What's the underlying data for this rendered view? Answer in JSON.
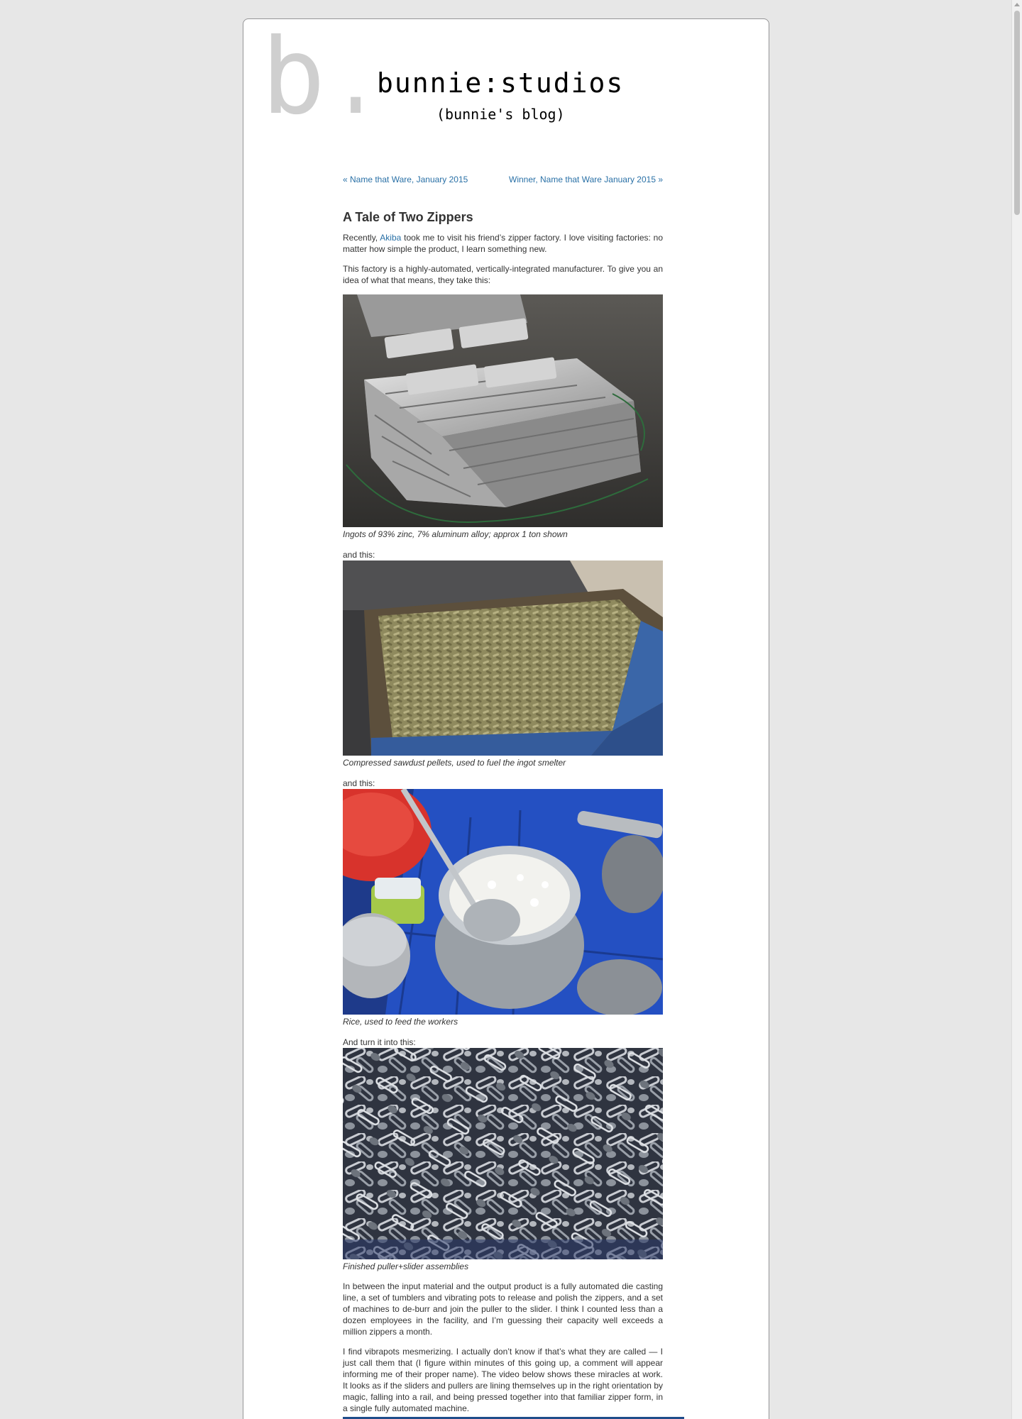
{
  "site": {
    "logo_letter": "b.",
    "title": "bunnie:studios",
    "description": "(bunnie's blog)"
  },
  "nav": {
    "prev": "« Name that Ware, January 2015",
    "next": "Winner, Name that Ware January 2015 »"
  },
  "post": {
    "title": "A Tale of Two Zippers",
    "p1_before": "Recently, ",
    "p1_link": "Akiba",
    "p1_after": " took me to visit his friend’s zipper factory. I love visiting factories: no matter how simple the product, I learn something new.",
    "p2": "This factory is a highly-automated, vertically-integrated manufacturer. To give you an idea of what that means, they take this:",
    "caption1": "Ingots of 93% zinc, 7% aluminum alloy; approx 1 ton shown",
    "lead2": "and this:",
    "caption2": "Compressed sawdust pellets, used to fuel the ingot smelter",
    "lead3": "and this:",
    "caption3": "Rice, used to feed the workers",
    "lead4": "And turn it into this:",
    "caption4": "Finished puller+slider assemblies",
    "p3": "In between the input material and the output product is a fully automated die casting line, a set of tumblers and vibrating pots to release and polish the zippers, and a set of machines to de-burr and join the puller to the slider. I think I counted less than a dozen employees in the facility, and I’m guessing their capacity well exceeds a million zippers a month.",
    "p4": "I find vibrapots mesmerizing. I actually don’t know if that’s what they are called — I just call them that (I figure within minutes of this going up, a comment will appear informing me of their proper name). The video below shows these miracles at work. It looks as if the sliders and pullers are lining themselves up in the right orientation by magic, falling into a rail, and being pressed together into that familiar zipper form, in a single fully automated machine."
  },
  "icons": {
    "scroll_up": "scroll-up-arrow-icon"
  }
}
